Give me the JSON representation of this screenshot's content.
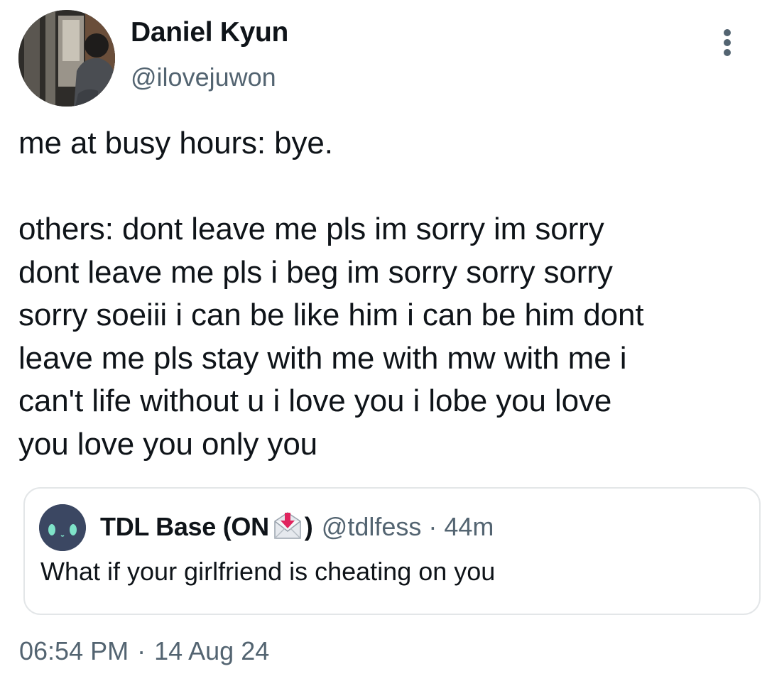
{
  "author": {
    "display_name": "Daniel Kyun",
    "handle": "@ilovejuwon",
    "avatar_icon": "user-avatar-photo"
  },
  "menu": {
    "icon": "more-vertical-icon"
  },
  "tweet": {
    "text": "me at busy hours: bye.\n\nothers: dont leave me pls im sorry im sorry\ndont leave me pls i beg im sorry sorry sorry\nsorry soeiii i can be like him i can be him dont\nleave me pls stay with me with mw with me i\ncan't life without u i love you i lobe you love\nyou love you only you"
  },
  "quote": {
    "display_name": "TDL Base (ON",
    "name_emoji": "inbox-envelope-icon",
    "name_close": ")",
    "handle": "@tdlfess",
    "separator": "·",
    "time": "44m",
    "text": "What if your girlfriend is cheating on you"
  },
  "footer": {
    "time": "06:54 PM",
    "separator": "·",
    "date": "14 Aug 24"
  },
  "colors": {
    "text_primary": "#0f1419",
    "text_secondary": "#536471",
    "border": "#e3e6e8",
    "quote_avatar_bg": "#3b4762",
    "quote_avatar_eyes": "#7fe3c9",
    "envelope_arrow": "#e0245e"
  }
}
